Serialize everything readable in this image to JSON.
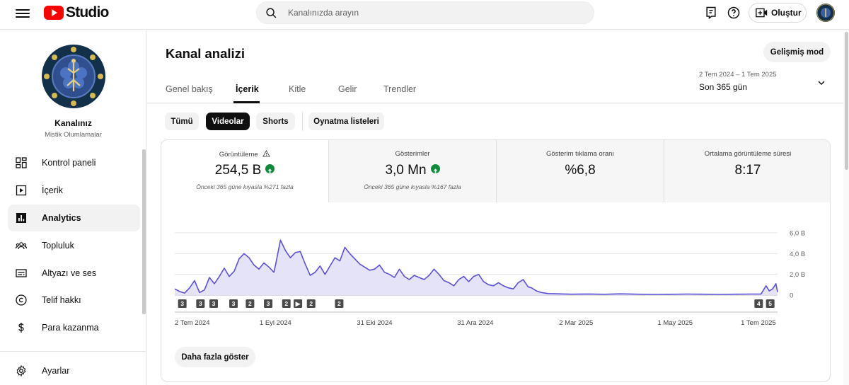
{
  "app": {
    "logo_text": "Studio",
    "brand_color": "#ff0000"
  },
  "search": {
    "placeholder": "Kanalınızda arayın"
  },
  "header": {
    "create_label": "Oluştur"
  },
  "channel": {
    "name": "Kanalınız",
    "subtitle": "Mistik Olumlamalar"
  },
  "sidebar": {
    "items": [
      {
        "label": "Kontrol paneli",
        "icon": "dashboard-icon"
      },
      {
        "label": "İçerik",
        "icon": "content-icon"
      },
      {
        "label": "Analytics",
        "icon": "analytics-icon",
        "active": true
      },
      {
        "label": "Topluluk",
        "icon": "community-icon"
      },
      {
        "label": "Altyazı ve ses",
        "icon": "subtitles-icon"
      },
      {
        "label": "Telif hakkı",
        "icon": "copyright-icon"
      },
      {
        "label": "Para kazanma",
        "icon": "monetization-icon"
      },
      {
        "label": "Ayarlar",
        "icon": "settings-icon"
      }
    ]
  },
  "page": {
    "title": "Kanal analizi",
    "advanced_mode_label": "Gelişmiş mod",
    "tabs": [
      "Genel bakış",
      "İçerik",
      "Kitle",
      "Gelir",
      "Trendler"
    ],
    "active_tab": "İçerik",
    "date_range": "2 Tem 2024 – 1 Tem 2025",
    "date_label": "Son 365 gün"
  },
  "filters": {
    "chips": [
      "Tümü",
      "Videolar",
      "Shorts",
      "Oynatma listeleri"
    ],
    "active": "Videolar"
  },
  "metrics": [
    {
      "title": "Görüntüleme",
      "value": "254,5 B",
      "trend": "up",
      "comparison": "Önceki 365 güne kıyasla %271 fazla"
    },
    {
      "title": "Gösterimler",
      "value": "3,0 Mn",
      "trend": "up",
      "comparison": "Önceki 365 güne kıyasla %167 fazla"
    },
    {
      "title": "Gösterim tıklama oranı",
      "value": "%6,8"
    },
    {
      "title": "Ortalama görüntüleme süresi",
      "value": "8:17"
    }
  ],
  "chart_data": {
    "type": "line",
    "y_tick_labels": [
      "0",
      "2,0 B",
      "4,0 B",
      "6,0 B"
    ],
    "y_ticks": [
      0,
      2000,
      4000,
      6000
    ],
    "ylim": [
      0,
      6000
    ],
    "x_tick_labels": [
      "2 Tem 2024",
      "1 Eyl 2024",
      "31 Eki 2024",
      "31 Ara 2024",
      "2 Mar 2025",
      "1 May 2025",
      "1 Tem 2025"
    ],
    "x_tick_days": [
      0,
      61,
      121,
      182,
      243,
      303,
      364
    ],
    "grid": true,
    "color": "#5b50d8",
    "fill": "#e5e3f7",
    "series": [
      {
        "points": [
          [
            0,
            600
          ],
          [
            3,
            350
          ],
          [
            6,
            200
          ],
          [
            9,
            700
          ],
          [
            12,
            1400
          ],
          [
            15,
            250
          ],
          [
            18,
            500
          ],
          [
            21,
            1700
          ],
          [
            24,
            1100
          ],
          [
            27,
            1800
          ],
          [
            30,
            2600
          ],
          [
            33,
            1800
          ],
          [
            36,
            2300
          ],
          [
            39,
            3500
          ],
          [
            42,
            4000
          ],
          [
            45,
            3600
          ],
          [
            48,
            2900
          ],
          [
            51,
            2500
          ],
          [
            54,
            3100
          ],
          [
            57,
            2700
          ],
          [
            60,
            2200
          ],
          [
            61,
            2900
          ],
          [
            64,
            5300
          ],
          [
            67,
            4300
          ],
          [
            70,
            3600
          ],
          [
            73,
            4100
          ],
          [
            76,
            4200
          ],
          [
            79,
            3000
          ],
          [
            82,
            1900
          ],
          [
            85,
            2200
          ],
          [
            88,
            2800
          ],
          [
            91,
            2000
          ],
          [
            94,
            2800
          ],
          [
            97,
            3600
          ],
          [
            100,
            3300
          ],
          [
            103,
            4600
          ],
          [
            106,
            4000
          ],
          [
            109,
            3500
          ],
          [
            112,
            3000
          ],
          [
            115,
            2700
          ],
          [
            118,
            2400
          ],
          [
            121,
            2500
          ],
          [
            124,
            2900
          ],
          [
            127,
            2200
          ],
          [
            130,
            2000
          ],
          [
            133,
            1700
          ],
          [
            136,
            2500
          ],
          [
            139,
            1800
          ],
          [
            142,
            1500
          ],
          [
            145,
            1900
          ],
          [
            148,
            1700
          ],
          [
            151,
            1500
          ],
          [
            154,
            1900
          ],
          [
            157,
            2500
          ],
          [
            160,
            2000
          ],
          [
            163,
            1400
          ],
          [
            166,
            1200
          ],
          [
            169,
            900
          ],
          [
            172,
            1500
          ],
          [
            175,
            1800
          ],
          [
            178,
            1300
          ],
          [
            181,
            1800
          ],
          [
            184,
            2000
          ],
          [
            187,
            1300
          ],
          [
            190,
            1000
          ],
          [
            193,
            900
          ],
          [
            196,
            1200
          ],
          [
            199,
            900
          ],
          [
            202,
            700
          ],
          [
            205,
            600
          ],
          [
            208,
            1200
          ],
          [
            211,
            1500
          ],
          [
            214,
            800
          ],
          [
            216,
            700
          ],
          [
            219,
            400
          ],
          [
            222,
            250
          ],
          [
            226,
            150
          ],
          [
            232,
            120
          ],
          [
            240,
            90
          ],
          [
            250,
            110
          ],
          [
            260,
            80
          ],
          [
            270,
            120
          ],
          [
            280,
            90
          ],
          [
            290,
            70
          ],
          [
            300,
            80
          ],
          [
            310,
            100
          ],
          [
            320,
            90
          ],
          [
            330,
            70
          ],
          [
            340,
            90
          ],
          [
            350,
            100
          ],
          [
            355,
            110
          ],
          [
            358,
            900
          ],
          [
            360,
            400
          ],
          [
            362,
            600
          ],
          [
            364,
            1100
          ],
          [
            365,
            300
          ]
        ]
      }
    ],
    "event_markers": [
      {
        "day": 2,
        "label": "3"
      },
      {
        "day": 13,
        "label": "3"
      },
      {
        "day": 21,
        "label": "3"
      },
      {
        "day": 33,
        "label": "3"
      },
      {
        "day": 43,
        "label": "2"
      },
      {
        "day": 54,
        "label": "3"
      },
      {
        "day": 65,
        "label": "2"
      },
      {
        "day": 72,
        "label": "▶"
      },
      {
        "day": 80,
        "label": "2"
      },
      {
        "day": 97,
        "label": "2"
      },
      {
        "day": 351,
        "label": "4"
      },
      {
        "day": 358,
        "label": "5"
      }
    ]
  },
  "chart": {
    "show_more_label": "Daha fazla göster"
  }
}
